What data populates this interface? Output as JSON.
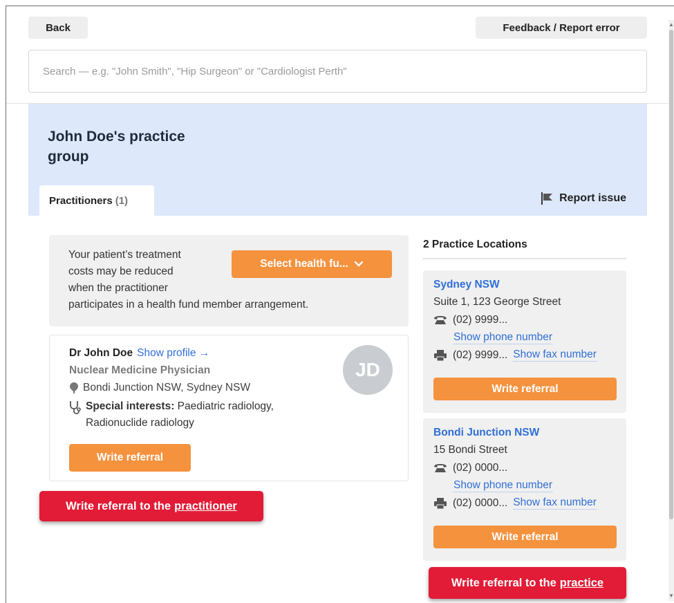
{
  "header": {
    "back_label": "Back",
    "feedback_label": "Feedback / Report error"
  },
  "search": {
    "placeholder": "Search — e.g. \"John Smith\", \"Hip Surgeon\" or \"Cardiologist Perth\"",
    "value": ""
  },
  "group": {
    "title": "John Doe's practice group",
    "tab_label": "Practitioners",
    "tab_count": "(1)",
    "report_issue_label": "Report issue"
  },
  "health_fund": {
    "lines": [
      "Your patient’s treatment",
      "costs may be reduced",
      "when the practitioner",
      "participates in a health fund member arrangement."
    ],
    "select_label": "Select health fu..."
  },
  "practitioner": {
    "name": "Dr John Doe",
    "show_profile_label": "Show profile →",
    "title": "Nuclear Medicine Physician",
    "locations": "Bondi Junction NSW, Sydney NSW",
    "interests_label": "Special interests:",
    "interests_value": "Paediatric radiology, Radionuclide radiology",
    "avatar_initials": "JD",
    "write_referral_label": "Write referral"
  },
  "callouts": {
    "practitioner_prefix": "Write referral to the",
    "practitioner_link": "practitioner",
    "practice_prefix": "Write referral to the",
    "practice_link": "practice"
  },
  "locations": {
    "heading": "2 Practice Locations",
    "items": [
      {
        "name": "Sydney NSW",
        "address": "Suite 1, 123 George Street",
        "phone": "(02) 9999...",
        "show_phone_label": "Show phone number",
        "fax": "(02) 9999...",
        "show_fax_label": "Show fax number",
        "write_referral_label": "Write referral"
      },
      {
        "name": "Bondi Junction NSW",
        "address": "15 Bondi Street",
        "phone": "(02) 0000...",
        "show_phone_label": "Show phone number",
        "fax": "(02) 0000...",
        "show_fax_label": "Show fax number",
        "write_referral_label": "Write referral"
      }
    ]
  },
  "icons": {
    "flag": "flag-icon",
    "chevron": "chevron-down-icon",
    "pin": "map-pin-icon",
    "stethoscope": "stethoscope-icon",
    "phone": "phone-icon",
    "fax": "fax-icon"
  },
  "colors": {
    "accent_orange": "#f5923e",
    "link_blue": "#2f6fd6",
    "banner_blue": "#dde8fa",
    "callout_red": "#e21b36"
  }
}
